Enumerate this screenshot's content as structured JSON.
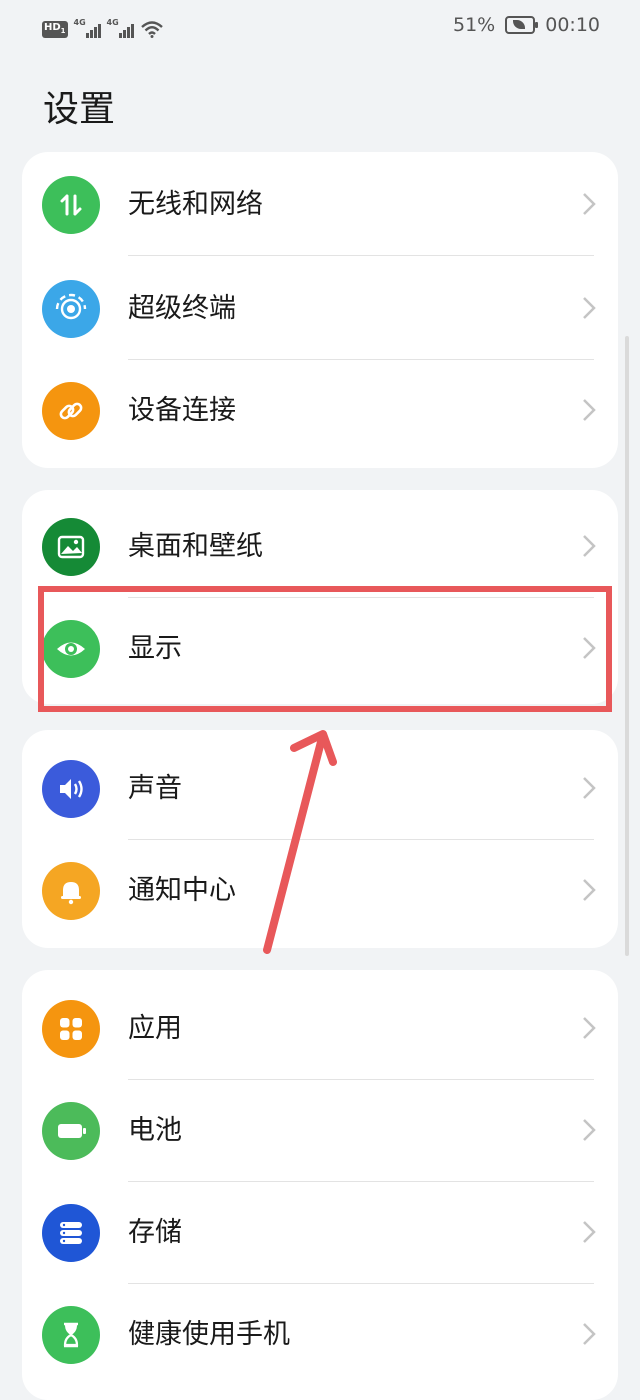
{
  "status_bar": {
    "hd_badge": "HD",
    "hd_sub": "1",
    "signal_1_label": "4G",
    "signal_2_label": "4G",
    "battery_percent": "51%",
    "time": "00:10"
  },
  "page_title": "设置",
  "groups": [
    {
      "items": [
        {
          "label": "无线和网络",
          "icon": "wireless-network-icon",
          "color": "#3dbf5a"
        },
        {
          "label": "超级终端",
          "icon": "super-device-icon",
          "color": "#3ba7e8"
        },
        {
          "label": "设备连接",
          "icon": "link-icon",
          "color": "#f5950f"
        }
      ]
    },
    {
      "items": [
        {
          "label": "桌面和壁纸",
          "icon": "wallpaper-icon",
          "color": "#158a36"
        },
        {
          "label": "显示",
          "icon": "eye-icon",
          "color": "#3dbf5a"
        }
      ]
    },
    {
      "items": [
        {
          "label": "声音",
          "icon": "speaker-icon",
          "color": "#3b5bdb"
        },
        {
          "label": "通知中心",
          "icon": "bell-icon",
          "color": "#f5a623"
        }
      ]
    },
    {
      "items": [
        {
          "label": "应用",
          "icon": "apps-grid-icon",
          "color": "#f5950f"
        },
        {
          "label": "电池",
          "icon": "battery-icon",
          "color": "#4cbb5a"
        },
        {
          "label": "存储",
          "icon": "storage-icon",
          "color": "#1f56d6"
        },
        {
          "label": "健康使用手机",
          "icon": "hourglass-icon",
          "color": "#3dbf5a"
        }
      ]
    }
  ],
  "annotation": {
    "highlight_color": "#e8585a"
  }
}
